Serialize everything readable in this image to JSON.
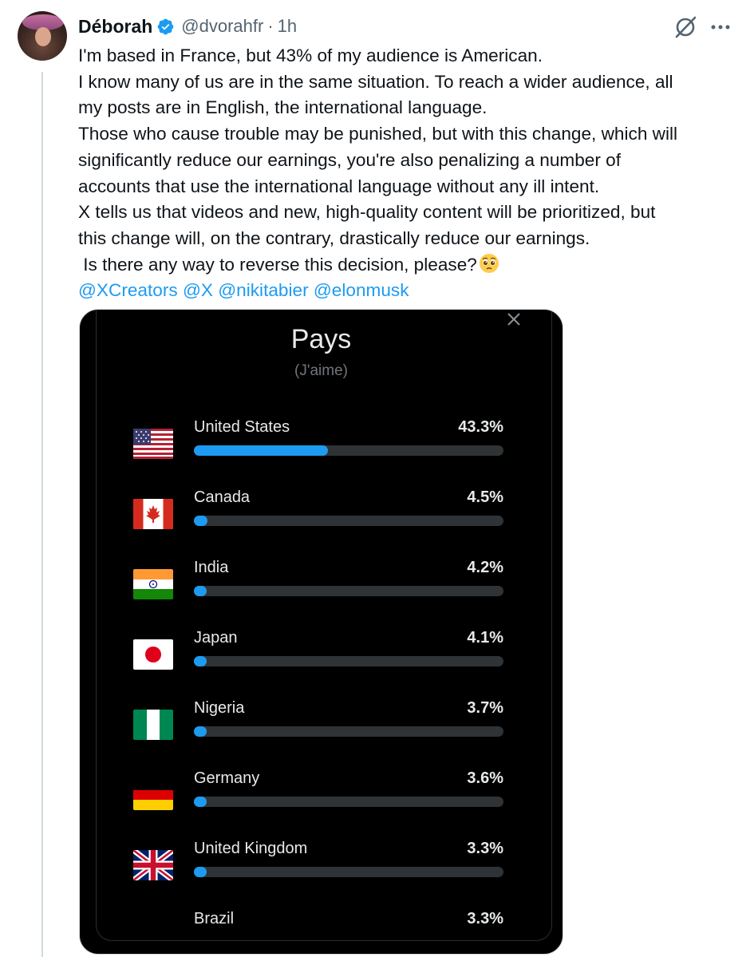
{
  "author": {
    "name": "Déborah",
    "handle": "@dvorahfr",
    "time": "1h",
    "separator": "·"
  },
  "post": {
    "lines": [
      "I'm based in France, but 43% of my audience is American.",
      "I know many of us are in the same situation. To reach a wider audience, all",
      "my posts are in English, the international language.",
      "Those who cause trouble may be punished, but with this change, which will",
      "significantly reduce our earnings, you're also penalizing a number of",
      "accounts that use the international language without any ill intent.",
      "X tells us that videos and new, high-quality content will be prioritized, but",
      "this change will, on the contrary, drastically reduce our earnings.",
      " Is there any way to reverse this decision, please?"
    ],
    "emoji": "pleading-face",
    "mentions": [
      "@XCreators",
      "@X",
      "@nikitabier",
      "@elonmusk"
    ]
  },
  "card": {
    "title": "Pays",
    "subtitle": "(J'aime)",
    "accent": "#1d9bf0",
    "rows": [
      {
        "country": "United States",
        "pct_label": "43.3%",
        "pct": 43.3,
        "flag": "us"
      },
      {
        "country": "Canada",
        "pct_label": "4.5%",
        "pct": 4.5,
        "flag": "ca"
      },
      {
        "country": "India",
        "pct_label": "4.2%",
        "pct": 4.2,
        "flag": "in"
      },
      {
        "country": "Japan",
        "pct_label": "4.1%",
        "pct": 4.1,
        "flag": "jp"
      },
      {
        "country": "Nigeria",
        "pct_label": "3.7%",
        "pct": 3.7,
        "flag": "ng"
      },
      {
        "country": "Germany",
        "pct_label": "3.6%",
        "pct": 3.6,
        "flag": "de"
      },
      {
        "country": "United Kingdom",
        "pct_label": "3.3%",
        "pct": 3.3,
        "flag": "gb"
      },
      {
        "country": "Brazil",
        "pct_label": "3.3%",
        "pct": 3.3,
        "flag": "br"
      }
    ]
  }
}
